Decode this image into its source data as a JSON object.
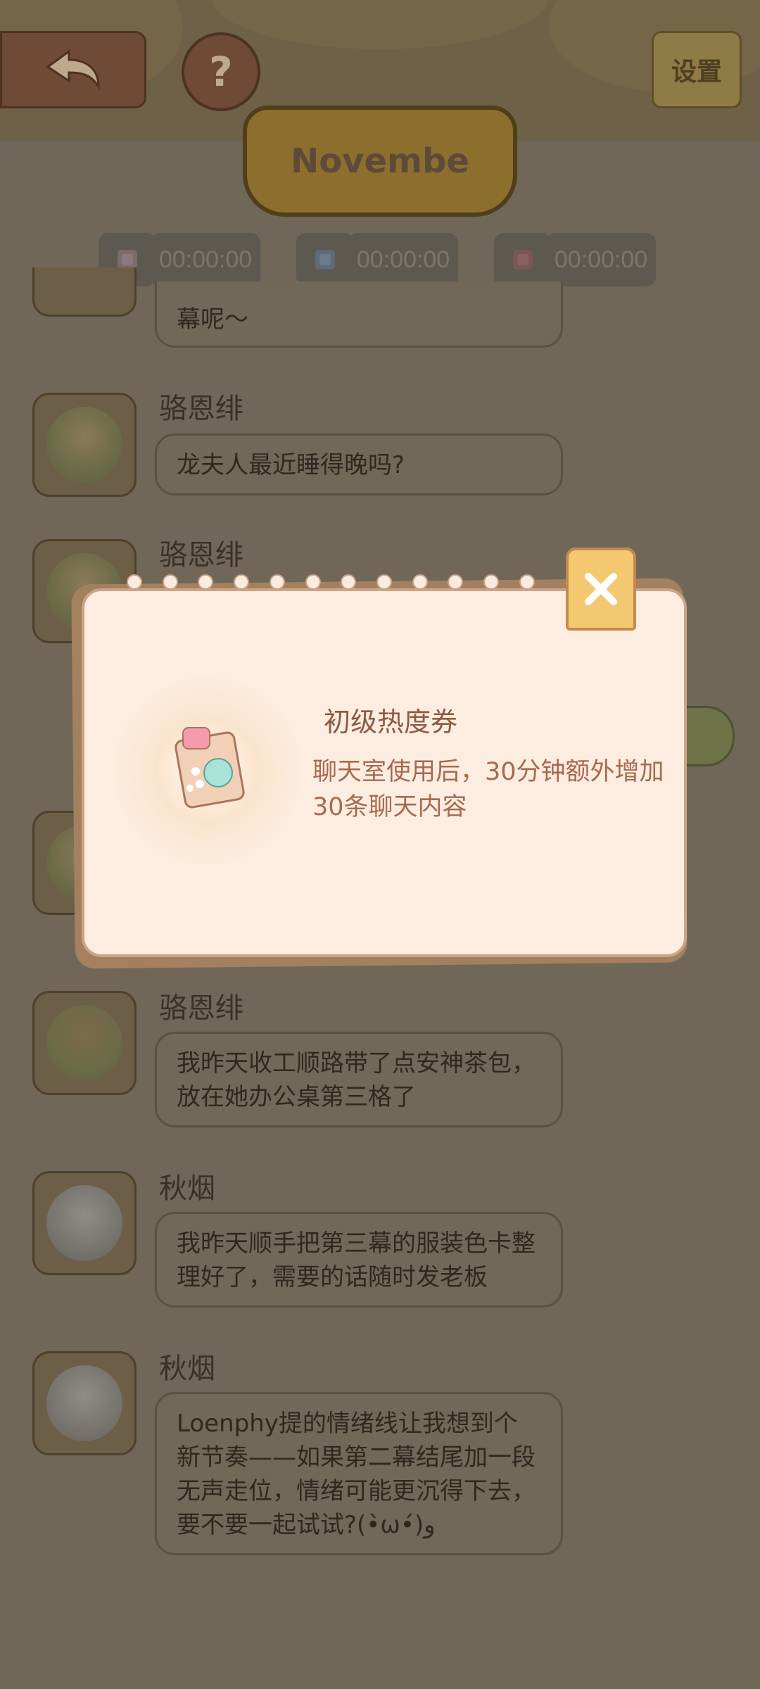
{
  "header": {
    "settings_label": "设置",
    "help_label": "?",
    "month": "Novembe"
  },
  "timers": [
    {
      "value": "00:00:00",
      "icon": "pink-ticket-icon"
    },
    {
      "value": "00:00:00",
      "icon": "blue-ticket-icon"
    },
    {
      "value": "00:00:00",
      "icon": "red-ticket-icon"
    }
  ],
  "messages": [
    {
      "name": "",
      "text": "龙夫人最近在为新剧本的第三幕呢～",
      "visible_text": "幕呢～"
    },
    {
      "name": "骆恩绯",
      "text": "龙夫人最近睡得晚吗?"
    },
    {
      "name": "骆恩绯",
      "text": ""
    },
    {
      "name": "骆恩绯",
      "text": "我昨天收工顺路带了点安神茶包，放在她办公桌第三格了"
    },
    {
      "name": "秋烟",
      "text": "我昨天顺手把第三幕的服装色卡整理好了，需要的话随时发老板"
    },
    {
      "name": "秋烟",
      "text": "Loenphy提的情绪线让我想到个新节奏——如果第二幕结尾加一段无声走位，情绪可能更沉得下去，要不要一起试试?(•̀ω•́)و"
    }
  ],
  "popup": {
    "item_name": "初级热度券",
    "item_desc": "聊天室使用后，30分钟额外增加30条聊天内容",
    "close_icon": "close-icon"
  }
}
